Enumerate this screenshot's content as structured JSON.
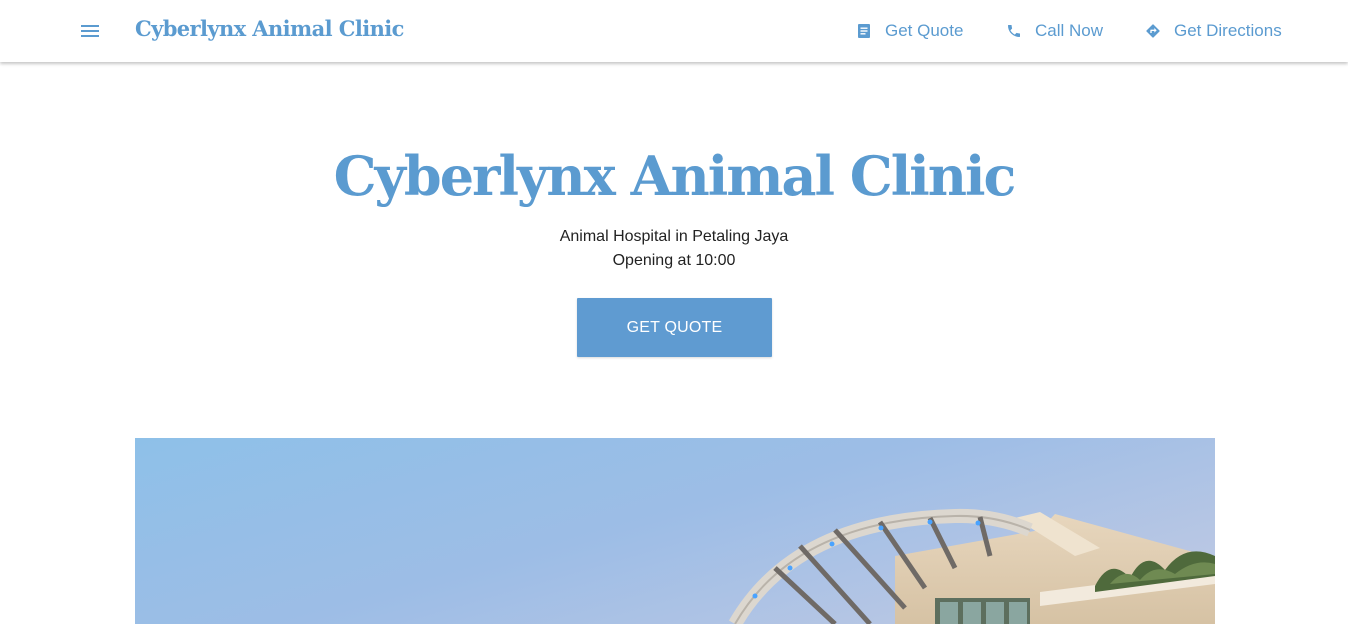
{
  "header": {
    "brand": "Cyberlynx Animal Clinic",
    "menu_icon": "hamburger-menu-icon",
    "actions": [
      {
        "label": "Get Quote",
        "icon": "document-icon"
      },
      {
        "label": "Call Now",
        "icon": "phone-icon"
      },
      {
        "label": "Get Directions",
        "icon": "directions-icon"
      }
    ]
  },
  "hero": {
    "title": "Cyberlynx Animal Clinic",
    "subtitle": "Animal Hospital in Petaling Jaya",
    "status": "Opening at 10:00",
    "cta_label": "GET QUOTE"
  },
  "colors": {
    "accent": "#5b9bd0",
    "button": "#5f9bd1",
    "text": "#222222"
  }
}
